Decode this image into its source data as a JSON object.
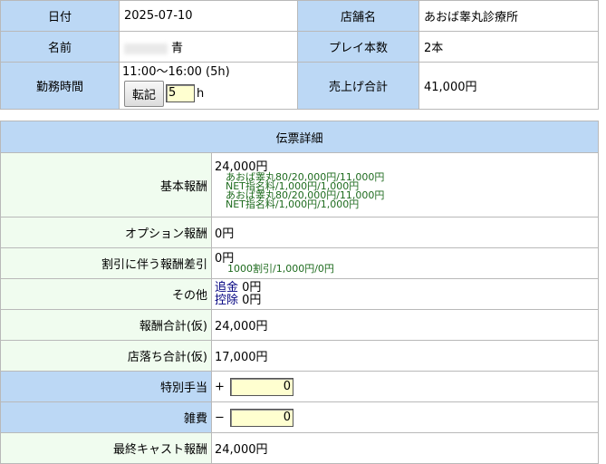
{
  "info": {
    "date_label": "日付",
    "date_value": "2025-07-10",
    "store_label": "店舗名",
    "store_value": "あおば睾丸診療所",
    "name_label": "名前",
    "name_value": "青",
    "play_label": "プレイ本数",
    "play_value": "2本",
    "work_label": "勤務時間",
    "work_time": "11:00～16:00 (5h)",
    "transfer_button": "転記",
    "hours_input": "5",
    "hours_unit": "h",
    "sales_label": "売上げ合計",
    "sales_value": "41,000円"
  },
  "detail": {
    "header": "伝票詳細",
    "basic_label": "基本報酬",
    "basic_total": "24,000円",
    "basic_items": [
      "あおば睾丸80/20,000円/11,000円",
      "NET指名料/1,000円/1,000円",
      "あおば睾丸80/20,000円/11,000円",
      "NET指名料/1,000円/1,000円"
    ],
    "option_label": "オプション報酬",
    "option_value": "0円",
    "discount_label": "割引に伴う報酬差引",
    "discount_value": "0円",
    "discount_item": "1000割引/1,000円/0円",
    "other_label": "その他",
    "other_add_label": "追金",
    "other_add_value": "0円",
    "other_deduct_label": "控除",
    "other_deduct_value": "0円",
    "reward_total_label": "報酬合計(仮)",
    "reward_total_value": "24,000円",
    "store_drop_label": "店落ち合計(仮)",
    "store_drop_value": "17,000円",
    "special_label": "特別手当",
    "special_sign": "+",
    "special_value": "0",
    "misc_label": "雑費",
    "misc_sign": "−",
    "misc_value": "0",
    "final_label": "最終キャスト報酬",
    "final_value": "24,000円"
  }
}
